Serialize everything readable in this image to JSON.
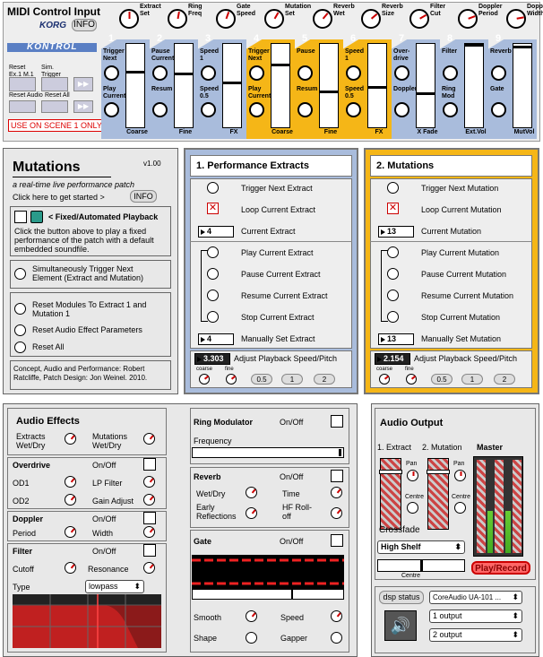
{
  "midi": {
    "title": "MIDI Control Input",
    "brand": "KORG",
    "info": "INFO",
    "kontrol": "KONTROL",
    "reset_ex": "Reset Ex.1 M.1",
    "sim_trigger": "Sim. Trigger",
    "reset_audio": "Reset Audio",
    "reset_all": "Reset All",
    "warning": "USE ON SCENE 1 ONLY!",
    "knob_labels": [
      "Extract Set",
      "Ring Freq",
      "Gate Speed",
      "Mutation Set",
      "Reverb Wet",
      "Reverb Size",
      "Filter Cut",
      "Doppler Period",
      "Doppler Width"
    ],
    "channels": [
      {
        "num": "1",
        "b1": "Trigger Next",
        "b2": "Play Current",
        "footer": "Coarse"
      },
      {
        "num": "2",
        "b1": "Pause Current",
        "b2": "Resum",
        "footer": "Fine"
      },
      {
        "num": "3",
        "b1": "Speed 1",
        "b2": "Speed 0.5",
        "footer": "FX"
      },
      {
        "num": "4",
        "b1": "Trigger Next",
        "b2": "Play Current",
        "footer": "Coarse"
      },
      {
        "num": "5",
        "b1": "Pause",
        "b2": "Resum",
        "footer": "Fine"
      },
      {
        "num": "6",
        "b1": "Speed 1",
        "b2": "Speed 0.5",
        "footer": "FX"
      },
      {
        "num": "7",
        "b1": "Over-drive",
        "b2": "Doppler",
        "footer": "X Fade"
      },
      {
        "num": "8",
        "b1": "Filter",
        "b2": "Ring Mod",
        "footer": "Ext.Vol"
      },
      {
        "num": "9",
        "b1": "Reverb",
        "b2": "Gate",
        "footer": "MutVol"
      }
    ],
    "colors": {
      "blue": "#a9bcdc",
      "orange": "#f5b617"
    }
  },
  "mutations": {
    "title": "Mutations",
    "version": "v1.00",
    "subtitle": "a real-time live performance patch",
    "started": "Click here to get started >",
    "info": "INFO",
    "fixed": "< Fixed/Automated Playback",
    "fixed_desc": "Click the button above to play a fixed performance of the patch with a default embedded soundfile.",
    "sim": "Simultaneously Trigger Next Element (Extract and Mutation)",
    "reset_modules": "Reset Modules To Extract 1 and Mutation 1",
    "reset_audio": "Reset Audio Effect Parameters",
    "reset_all": "Reset All",
    "credits": "Concept, Audio and Performance: Robert Ratcliffe, Patch Design: Jon Weinel.  2010."
  },
  "perf": {
    "title": "1. Performance Extracts",
    "items": [
      "Trigger Next Extract",
      "Loop Current Extract",
      "Current Extract",
      "Play Current Extract",
      "Pause Current Extract",
      "Resume Current Extract",
      "Stop Current Extract",
      "Manually Set Extract"
    ],
    "current": "4",
    "manual": "4",
    "speed": "3.303",
    "speed_label": "Adjust Playback Speed/Pitch",
    "coarse": "coarse",
    "fine": "fine",
    "b1": "0.5",
    "b2": "1",
    "b3": "2"
  },
  "mut": {
    "title": "2. Mutations",
    "items": [
      "Trigger Next Mutation",
      "Loop Current Mutation",
      "Current Mutation",
      "Play Current Mutation",
      "Pause Current Mutation",
      "Resume Current Mutation",
      "Stop Current Mutation",
      "Manually Set Mutation"
    ],
    "current": "13",
    "manual": "13",
    "speed": "2.154",
    "speed_label": "Adjust Playback Speed/Pitch",
    "coarse": "coarse",
    "fine": "fine",
    "b1": "0.5",
    "b2": "1",
    "b3": "2"
  },
  "fx": {
    "title": "Audio Effects",
    "extracts_wd": "Extracts Wet/Dry",
    "mutations_wd": "Mutations Wet/Dry",
    "overdrive": "Overdrive",
    "onoff": "On/Off",
    "od1": "OD1",
    "lp_filter": "LP Filter",
    "od2": "OD2",
    "gain_adjust": "Gain Adjust",
    "doppler": "Doppler",
    "period": "Period",
    "width": "Width",
    "filter": "Filter",
    "cutoff": "Cutoff",
    "resonance": "Resonance",
    "type": "Type",
    "type_value": "lowpass",
    "ringmod": "Ring Modulator",
    "frequency": "Frequency",
    "reverb": "Reverb",
    "wetdry": "Wet/Dry",
    "time": "Time",
    "early": "Early Reflections",
    "hf": "HF Roll-off",
    "gate": "Gate",
    "smooth": "Smooth",
    "speed": "Speed",
    "shape": "Shape",
    "gapper": "Gapper"
  },
  "out": {
    "title": "Audio Output",
    "extract": "1. Extract",
    "mutation": "2. Mutation",
    "master": "Master",
    "pan": "Pan",
    "centre": "Centre",
    "crossfade": "Crossfade",
    "shelf": "High Shelf",
    "centre2": "Centre",
    "play": "Play/Record",
    "dsp": "dsp status",
    "driver": "CoreAudio UA-101 ...",
    "in": "1 output",
    "out2": "2 output"
  }
}
